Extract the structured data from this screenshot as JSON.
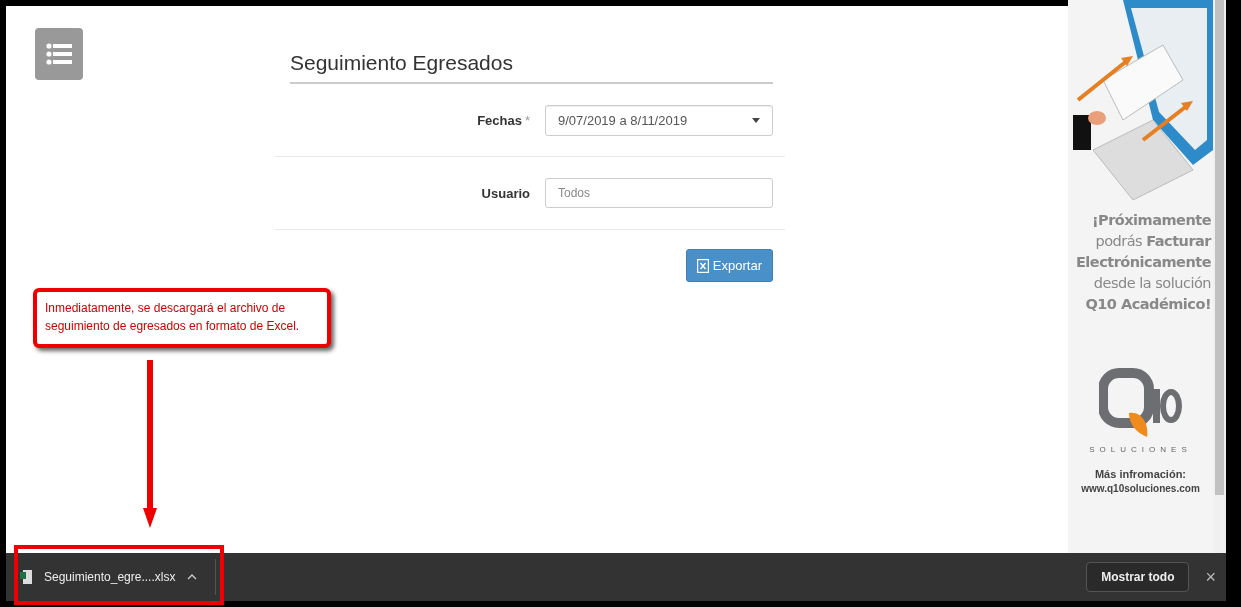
{
  "form": {
    "title": "Seguimiento Egresados",
    "fields": [
      {
        "kind": "select",
        "label": "Fechas",
        "required_mark": "*",
        "value": "9/07/2019 a 8/11/2019"
      },
      {
        "kind": "text",
        "label": "Usuario",
        "placeholder": "Todos"
      }
    ],
    "export_button": "Exportar"
  },
  "callout": {
    "text": "Inmediatamente, se descargará el archivo de seguimiento de egresados en formato de Excel."
  },
  "ad": {
    "headline": "**¡Próximamente** podrás **Facturar Electrónicamente** desde la solución **Q10 Académico!**",
    "logo_tagline": "SOLUCIONES",
    "more_info": "Más infromación:",
    "url": "www.q10soluciones.com"
  },
  "download_bar": {
    "file": "Seguimiento_egre....xlsx",
    "show_all": "Mostrar todo",
    "close": "×"
  }
}
